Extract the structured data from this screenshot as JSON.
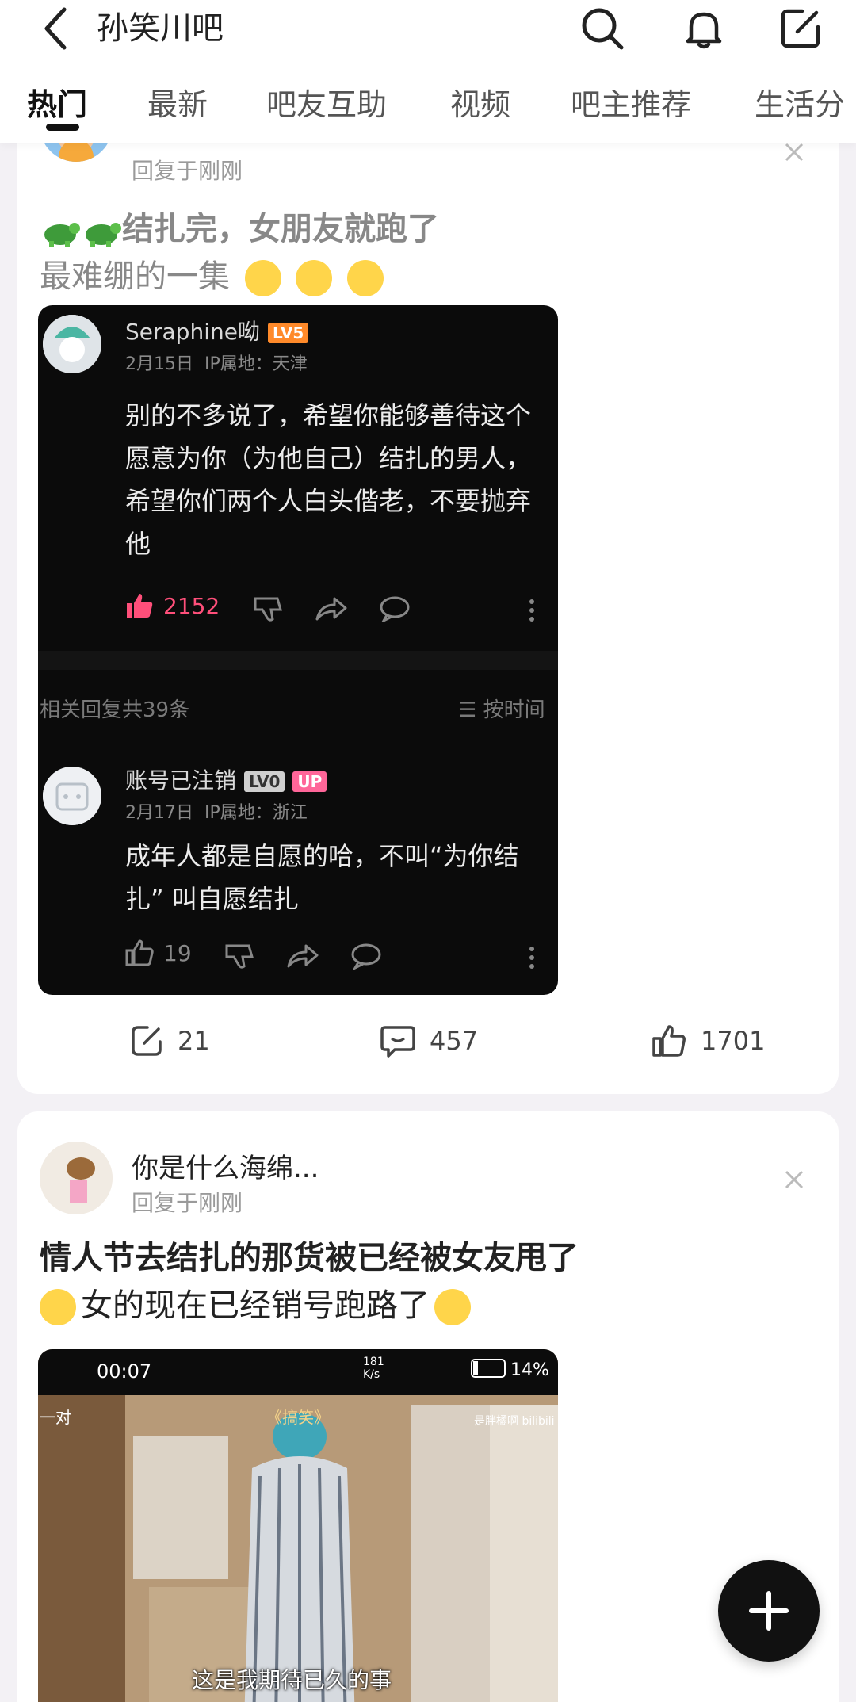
{
  "header": {
    "title": "孙笑川吧"
  },
  "tabs": [
    "热门",
    "最新",
    "吧友互助",
    "视频",
    "吧主推荐",
    "生活分"
  ],
  "post1": {
    "meta": "回复于刚刚",
    "title": "结扎完，女朋友就跑了",
    "body": "最难绷的一集",
    "screenshot": {
      "comment1": {
        "user": "Seraphine呦",
        "level": "LV5",
        "date": "2月15日",
        "ip": "IP属地：天津",
        "text": "别的不多说了，希望你能够善待这个愿意为你（为他自己）结扎的男人，希望你们两个人白头偕老，不要抛弃他",
        "likes": "2152"
      },
      "replies_count": "相关回复共39条",
      "sort": "按时间",
      "comment2": {
        "user": "账号已注销",
        "level": "LV0",
        "badge": "UP",
        "date": "2月17日",
        "ip": "IP属地：浙江",
        "text": "成年人都是自愿的哈，不叫“为你结扎” 叫自愿结扎",
        "likes": "19"
      }
    },
    "shares": "21",
    "comments": "457",
    "likes": "1701"
  },
  "post2": {
    "user": "你是什么海绵...",
    "meta": "回复于刚刚",
    "title": "情人节去结扎的那货被已经被女友甩了",
    "body": "女的现在已经销号跑路了",
    "video": {
      "status_time": "00:07",
      "battery": "14%",
      "net": "181 K/s",
      "left_tag": "一对",
      "top_caption": "《搞笑》",
      "watermark": "是胖橘啊 bilibili",
      "subtitle": "这是我期待已久的事"
    }
  },
  "colors": {
    "accent_pink": "#ff4f7a",
    "bg": "#f3f1f5",
    "fab": "#111111"
  }
}
